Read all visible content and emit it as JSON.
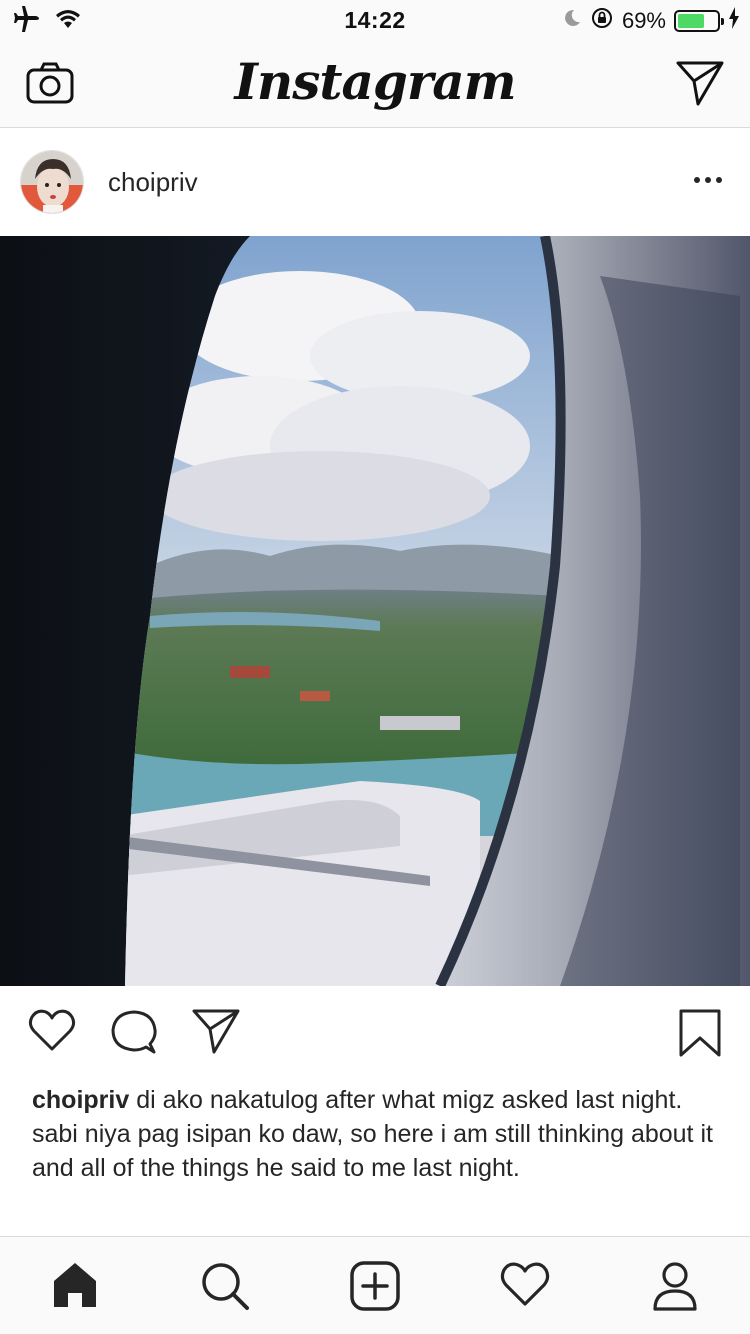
{
  "status_bar": {
    "time": "14:22",
    "battery_percent": "69%",
    "battery_level": 0.69,
    "icons": [
      "airplane-icon",
      "wifi-icon",
      "moon-icon",
      "orientation-lock-icon",
      "battery-icon",
      "charging-icon"
    ]
  },
  "header": {
    "logo": "Instagram",
    "icons": [
      "camera-icon",
      "direct-message-icon"
    ]
  },
  "post": {
    "username": "choipriv",
    "photo_description_icon": "airplane-window-photo",
    "actions": [
      "like-icon",
      "comment-icon",
      "share-icon",
      "bookmark-icon"
    ],
    "caption_user": "choipriv",
    "caption_text": " di ako nakatulog after what migz asked last night. sabi niya pag isipan ko daw, so here i am still thinking about it and all of the things he said to me last night."
  },
  "tab_bar": {
    "items": [
      "home-icon",
      "search-icon",
      "new-post-icon",
      "activity-icon",
      "profile-icon"
    ]
  },
  "colors": {
    "text": "#262626",
    "battery_fill": "#4cd964",
    "border": "#dbdbdb",
    "bar_bg": "#fafafa"
  }
}
